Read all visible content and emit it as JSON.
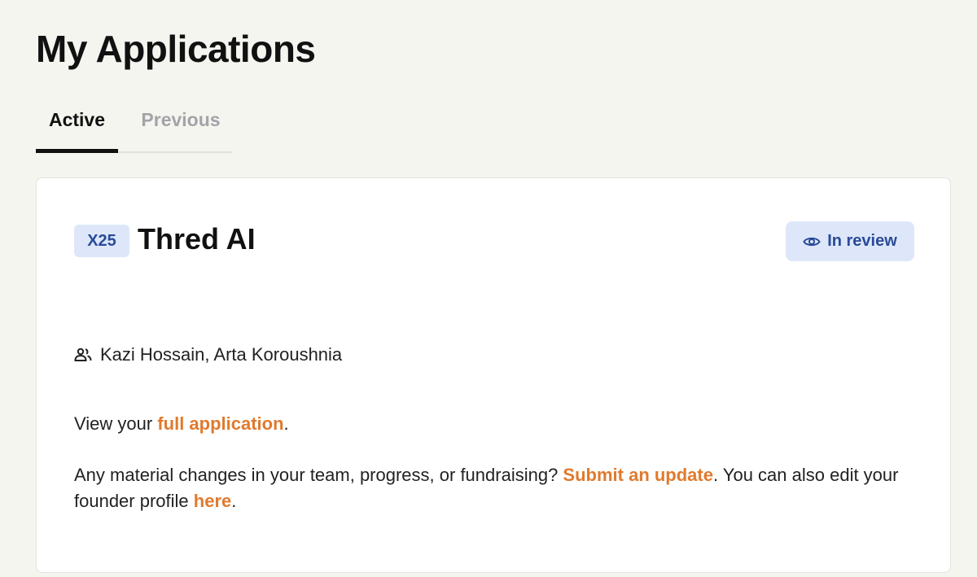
{
  "page": {
    "title": "My Applications"
  },
  "tabs": [
    {
      "label": "Active",
      "selected": true
    },
    {
      "label": "Previous",
      "selected": false
    }
  ],
  "application": {
    "batch": "X25",
    "company": "Thred AI",
    "status": "In review",
    "status_icon": "eye-icon",
    "founders_icon": "people-icon",
    "founders": "Kazi Hossain, Arta Koroushnia",
    "view_prefix": "View your ",
    "view_link": "full application",
    "view_suffix": ".",
    "update_prefix": "Any material changes in your team, progress, or fundraising? ",
    "update_link": "Submit an update",
    "update_middle": ". You can also edit your founder profile ",
    "profile_link": "here",
    "update_suffix": "."
  },
  "colors": {
    "background": "#f5f5f0",
    "accent_link": "#e07a2e",
    "badge_bg": "#dde7f9",
    "badge_text": "#2a4a99"
  }
}
